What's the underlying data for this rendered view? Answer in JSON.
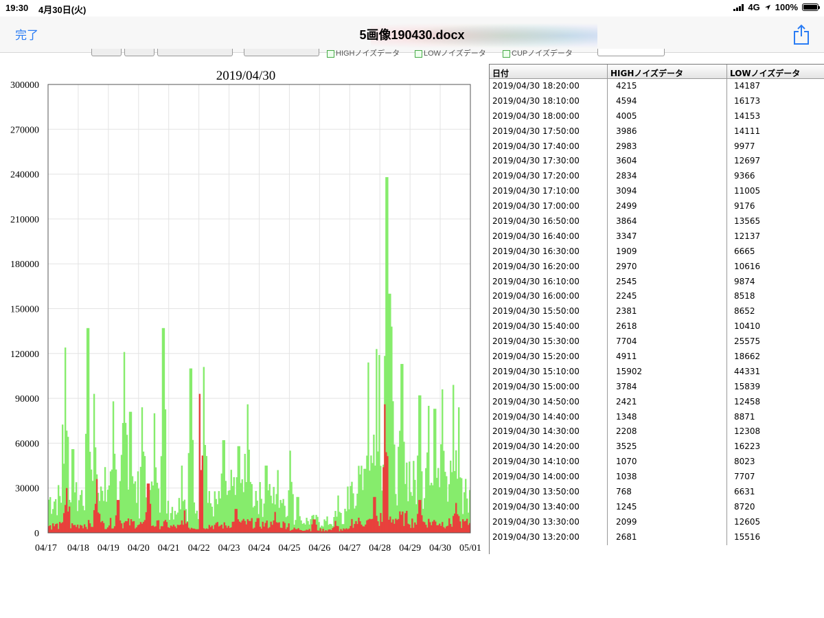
{
  "status_bar": {
    "time": "19:30",
    "date": "4月30日(火)",
    "network": "4G",
    "battery": "100%"
  },
  "nav": {
    "done_label": "完了",
    "title": "5画像190430.docx",
    "share_icon": "share-icon",
    "accent_color": "#2a7cf4"
  },
  "chart_data": {
    "type": "bar",
    "title": "2019/04/30",
    "xlabel": "",
    "ylabel": "",
    "x_ticks": [
      "04/17",
      "04/18",
      "04/19",
      "04/20",
      "04/21",
      "04/22",
      "04/23",
      "04/24",
      "04/25",
      "04/26",
      "04/27",
      "04/28",
      "04/29",
      "04/30",
      "05/01"
    ],
    "y_ticks": [
      0,
      30000,
      60000,
      90000,
      120000,
      150000,
      180000,
      210000,
      240000,
      270000,
      300000
    ],
    "ylim": [
      0,
      300000
    ],
    "grid": true,
    "series": [
      {
        "color": "#86ec6c",
        "days": [
          {
            "day": "04/17",
            "base": 28000,
            "peaks": [
              {
                "t": 0.55,
                "v": 124000
              },
              {
                "t": 0.8,
                "v": 56000
              }
            ]
          },
          {
            "day": "04/18",
            "base": 30000,
            "peaks": [
              {
                "t": 0.3,
                "v": 137000
              },
              {
                "t": 0.5,
                "v": 93000
              },
              {
                "t": 0.85,
                "v": 44000
              }
            ]
          },
          {
            "day": "04/19",
            "base": 34000,
            "peaks": [
              {
                "t": 0.15,
                "v": 88000
              },
              {
                "t": 0.5,
                "v": 121000
              },
              {
                "t": 0.7,
                "v": 81000
              }
            ]
          },
          {
            "day": "04/20",
            "base": 27000,
            "peaks": [
              {
                "t": 0.1,
                "v": 84000
              },
              {
                "t": 0.5,
                "v": 80000
              },
              {
                "t": 0.8,
                "v": 137000
              }
            ]
          },
          {
            "day": "04/21",
            "base": 22000,
            "peaks": [
              {
                "t": 0.7,
                "v": 110000
              },
              {
                "t": 0.4,
                "v": 45000
              }
            ]
          },
          {
            "day": "04/22",
            "base": 24000,
            "peaks": [
              {
                "t": 0.15,
                "v": 111000
              },
              {
                "t": 0.8,
                "v": 62000
              }
            ]
          },
          {
            "day": "04/23",
            "base": 34000,
            "peaks": [
              {
                "t": 0.3,
                "v": 58000
              },
              {
                "t": 0.6,
                "v": 86000
              }
            ]
          },
          {
            "day": "04/24",
            "base": 28000,
            "peaks": [
              {
                "t": 0.2,
                "v": 45000
              },
              {
                "t": 0.6,
                "v": 42000
              }
            ]
          },
          {
            "day": "04/25",
            "base": 10000,
            "peaks": [
              {
                "t": 0.0,
                "v": 55000
              },
              {
                "t": 0.25,
                "v": 24000
              }
            ]
          },
          {
            "day": "04/26",
            "base": 9000,
            "peaks": [
              {
                "t": 0.6,
                "v": 25000
              },
              {
                "t": 0.9,
                "v": 31000
              }
            ]
          },
          {
            "day": "04/27",
            "base": 38000,
            "peaks": [
              {
                "t": 0.6,
                "v": 114000
              },
              {
                "t": 0.85,
                "v": 123000
              },
              {
                "t": 0.95,
                "v": 119000
              }
            ]
          },
          {
            "day": "04/28",
            "base": 52000,
            "peaks": [
              {
                "t": 0.2,
                "v": 238000
              },
              {
                "t": 0.3,
                "v": 160000
              },
              {
                "t": 0.35,
                "v": 138000
              },
              {
                "t": 0.7,
                "v": 113000
              }
            ]
          },
          {
            "day": "04/29",
            "base": 40000,
            "peaks": [
              {
                "t": 0.3,
                "v": 92000
              },
              {
                "t": 0.6,
                "v": 85000
              },
              {
                "t": 0.8,
                "v": 83000
              }
            ]
          },
          {
            "day": "04/30",
            "base": 36000,
            "peaks": [
              {
                "t": 0.05,
                "v": 96000
              },
              {
                "t": 0.4,
                "v": 99000
              },
              {
                "t": 0.6,
                "v": 84000
              }
            ]
          }
        ]
      },
      {
        "color": "#e8413c",
        "days": [
          {
            "day": "04/17",
            "base": 6000,
            "peaks": [
              {
                "t": 0.6,
                "v": 30000
              }
            ]
          },
          {
            "day": "04/18",
            "base": 7000,
            "peaks": [
              {
                "t": 0.6,
                "v": 36000
              }
            ]
          },
          {
            "day": "04/19",
            "base": 8000,
            "peaks": [
              {
                "t": 0.3,
                "v": 22000
              }
            ]
          },
          {
            "day": "04/20",
            "base": 7000,
            "peaks": [
              {
                "t": 0.3,
                "v": 33000
              }
            ]
          },
          {
            "day": "04/21",
            "base": 5000,
            "peaks": [
              {
                "t": 0.5,
                "v": 15000
              }
            ]
          },
          {
            "day": "04/22",
            "base": 6000,
            "peaks": [
              {
                "t": 0.0,
                "v": 93000
              }
            ]
          },
          {
            "day": "04/23",
            "base": 8000,
            "peaks": [
              {
                "t": 0.2,
                "v": 16000
              }
            ]
          },
          {
            "day": "04/24",
            "base": 7000,
            "peaks": [
              {
                "t": 0.5,
                "v": 14000
              }
            ]
          },
          {
            "day": "04/25",
            "base": 3000,
            "peaks": [
              {
                "t": 0.8,
                "v": 9000
              }
            ]
          },
          {
            "day": "04/26",
            "base": 2500,
            "peaks": [
              {
                "t": 0.5,
                "v": 8000
              }
            ]
          },
          {
            "day": "04/27",
            "base": 9000,
            "peaks": [
              {
                "t": 0.8,
                "v": 24000
              }
            ]
          },
          {
            "day": "04/28",
            "base": 12000,
            "peaks": [
              {
                "t": 0.15,
                "v": 86000
              }
            ]
          },
          {
            "day": "04/29",
            "base": 9000,
            "peaks": [
              {
                "t": 0.3,
                "v": 22000
              }
            ]
          },
          {
            "day": "04/30",
            "base": 8000,
            "peaks": [
              {
                "t": 0.5,
                "v": 20000
              }
            ]
          }
        ]
      }
    ]
  },
  "toolbar": {
    "checkbox_labels": [
      "HIGHノイズデータ",
      "LOWノイズデータ",
      "CUPノイズデータ"
    ]
  },
  "table": {
    "headers": [
      "日付",
      "HIGHノイズデータ",
      "LOWノイズデータ"
    ],
    "rows": [
      [
        "2019/04/30 18:20:00",
        "4215",
        "14187"
      ],
      [
        "2019/04/30 18:10:00",
        "4594",
        "16173"
      ],
      [
        "2019/04/30 18:00:00",
        "4005",
        "14153"
      ],
      [
        "2019/04/30 17:50:00",
        "3986",
        "14111"
      ],
      [
        "2019/04/30 17:40:00",
        "2983",
        "9977"
      ],
      [
        "2019/04/30 17:30:00",
        "3604",
        "12697"
      ],
      [
        "2019/04/30 17:20:00",
        "2834",
        "9366"
      ],
      [
        "2019/04/30 17:10:00",
        "3094",
        "11005"
      ],
      [
        "2019/04/30 17:00:00",
        "2499",
        "9176"
      ],
      [
        "2019/04/30 16:50:00",
        "3864",
        "13565"
      ],
      [
        "2019/04/30 16:40:00",
        "3347",
        "12137"
      ],
      [
        "2019/04/30 16:30:00",
        "1909",
        "6665"
      ],
      [
        "2019/04/30 16:20:00",
        "2970",
        "10616"
      ],
      [
        "2019/04/30 16:10:00",
        "2545",
        "9874"
      ],
      [
        "2019/04/30 16:00:00",
        "2245",
        "8518"
      ],
      [
        "2019/04/30 15:50:00",
        "2381",
        "8652"
      ],
      [
        "2019/04/30 15:40:00",
        "2618",
        "10410"
      ],
      [
        "2019/04/30 15:30:00",
        "7704",
        "25575"
      ],
      [
        "2019/04/30 15:20:00",
        "4911",
        "18662"
      ],
      [
        "2019/04/30 15:10:00",
        "15902",
        "44331"
      ],
      [
        "2019/04/30 15:00:00",
        "3784",
        "15839"
      ],
      [
        "2019/04/30 14:50:00",
        "2421",
        "12458"
      ],
      [
        "2019/04/30 14:40:00",
        "1348",
        "8871"
      ],
      [
        "2019/04/30 14:30:00",
        "2208",
        "12308"
      ],
      [
        "2019/04/30 14:20:00",
        "3525",
        "16223"
      ],
      [
        "2019/04/30 14:10:00",
        "1070",
        "8023"
      ],
      [
        "2019/04/30 14:00:00",
        "1038",
        "7707"
      ],
      [
        "2019/04/30 13:50:00",
        "768",
        "6631"
      ],
      [
        "2019/04/30 13:40:00",
        "1245",
        "8720"
      ],
      [
        "2019/04/30 13:30:00",
        "2099",
        "12605"
      ],
      [
        "2019/04/30 13:20:00",
        "2681",
        "15516"
      ]
    ]
  }
}
